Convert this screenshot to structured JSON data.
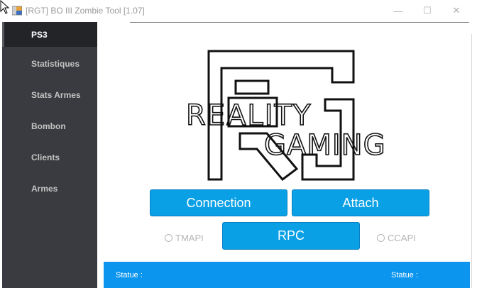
{
  "window": {
    "title": "[RGT] BO III Zombie Tool [1.07]",
    "minimize_glyph": "—",
    "maximize_glyph": "☐",
    "close_glyph": "✕"
  },
  "sidebar": {
    "items": [
      {
        "label": "PS3",
        "active": true
      },
      {
        "label": "Statistiques",
        "active": false
      },
      {
        "label": "Stats Armes",
        "active": false
      },
      {
        "label": "Bombon",
        "active": false
      },
      {
        "label": "Clients",
        "active": false
      },
      {
        "label": "Armes",
        "active": false
      }
    ]
  },
  "logo": {
    "line1": "REALITY",
    "line2": "GAMING",
    "icon": "rg-logo"
  },
  "buttons": {
    "connection": "Connection",
    "attach": "Attach",
    "rpc": "RPC"
  },
  "radios": {
    "tmapi": "TMAPI",
    "ccapi": "CCAPI"
  },
  "status": {
    "left_label": "Statue :",
    "right_label": "Statue :"
  },
  "colors": {
    "sidebar_bg": "#393b40",
    "sidebar_active": "#232428",
    "accent": "#0aa0e6",
    "statusbar": "#0b95ef"
  }
}
